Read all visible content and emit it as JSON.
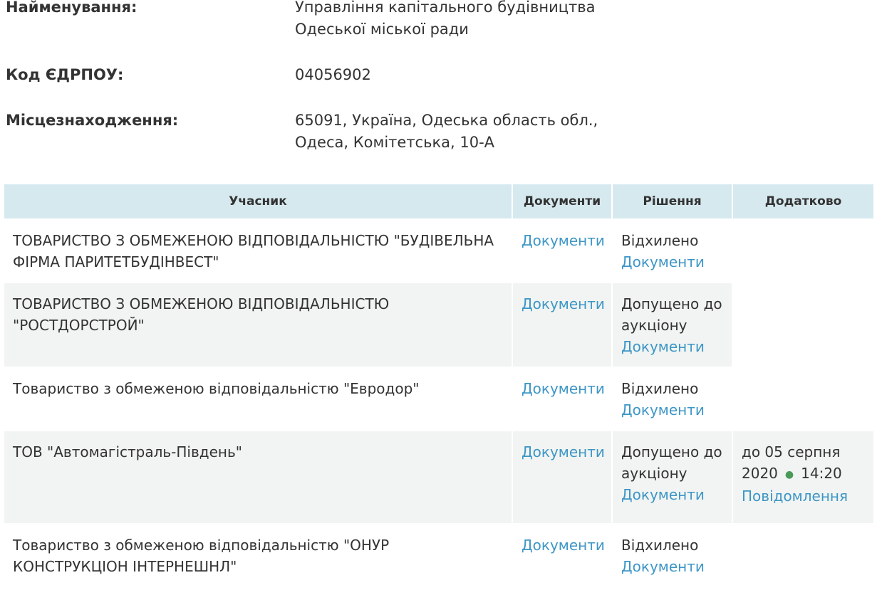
{
  "organization": {
    "name_label": "Найменування:",
    "name_lines": [
      "Управління капітального будівництва",
      "Одеської міської ради"
    ],
    "code_label": "Код ЄДРПОУ:",
    "code_value": "04056902",
    "location_label": "Місцезнаходження:",
    "location_lines": [
      "65091, Україна, Одеська область обл.,",
      "Одеса, Комітетська, 10-А"
    ]
  },
  "table": {
    "headers": {
      "participant": "Учасник",
      "documents": "Документи",
      "decision": "Рішення",
      "additional": "Додатково"
    },
    "rows": [
      {
        "participant": "ТОВАРИСТВО З ОБМЕЖЕНОЮ ВІДПОВІДАЛЬНІСТЮ \"БУДІВЕЛЬНА ФІРМА ПАРИТЕТБУДІНВЕСТ\"",
        "documents_link": "Документи",
        "decision_status": "Відхилено",
        "decision_link": "Документи"
      },
      {
        "participant": "ТОВАРИСТВО З ОБМЕЖЕНОЮ ВІДПОВІДАЛЬНІСТЮ \"РОСТДОРСТРОЙ\"",
        "documents_link": "Документи",
        "decision_status": "Допущено до аукціону",
        "decision_link": "Документи"
      },
      {
        "participant": "Товариство з обмеженою відповідальністю \"Евродор\"",
        "documents_link": "Документи",
        "decision_status": "Відхилено",
        "decision_link": "Документи"
      },
      {
        "participant": "ТОВ \"Автомагістраль-Південь\"",
        "documents_link": "Документи",
        "decision_status": "Допущено до аукціону",
        "decision_link": "Документи",
        "additional_deadline": "до 05 серпня 2020",
        "additional_time": "14:20",
        "additional_link": "Повідомлення"
      },
      {
        "participant": "Товариство з обмеженою відповідальністю \"ОНУР КОНСТРУКЦІОН ІНТЕРНЕШНЛ\"",
        "documents_link": "Документи",
        "decision_status": "Відхилено",
        "decision_link": "Документи"
      }
    ]
  },
  "colors": {
    "header_bg": "#d6e9ef",
    "alt_row_bg": "#f1f4f2",
    "link": "#3d96c6",
    "text": "#333333",
    "dot": "#4a9a5a"
  }
}
